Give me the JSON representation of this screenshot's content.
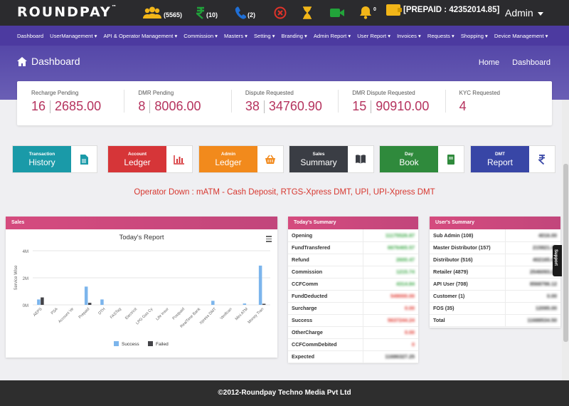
{
  "topbar": {
    "logo": "ROUNDPAY",
    "logo_mark": "™",
    "users_count": "(5565)",
    "rupee_count": "(10)",
    "calls_count": "(2)",
    "notif_count": "0",
    "prepaid": "[PREPAID : 42352014.85]",
    "admin": "Admin",
    "colors": {
      "users": "#f2b619",
      "rupee": "#20a13a",
      "phone": "#1f6fd6",
      "cancel": "#e0332a",
      "hourglass": "#f2b619",
      "video": "#22a33a",
      "bell": "#f2b619"
    }
  },
  "nav": [
    "Dashboard",
    "UserManagement ▾",
    "API & Operator Management ▾",
    "Commission ▾",
    "Masters ▾",
    "Setting ▾",
    "Branding ▾",
    "Admin Report ▾",
    "User Report ▾",
    "Invoices ▾",
    "Requests ▾",
    "Shopping ▾",
    "Device Management ▾"
  ],
  "header": {
    "title": "Dashboard",
    "breadcrumbs": [
      "Home",
      "Dashboard"
    ]
  },
  "stats": [
    {
      "label": "Recharge Pending",
      "count": "16",
      "amount": "2685.00"
    },
    {
      "label": "DMR Pending",
      "count": "8",
      "amount": "8006.00"
    },
    {
      "label": "Dispute Requested",
      "count": "38",
      "amount": "34760.90"
    },
    {
      "label": "DMR Dispute Requested",
      "count": "15",
      "amount": "90910.00"
    },
    {
      "label": "KYC Requested",
      "count": "4",
      "amount": ""
    }
  ],
  "quick": [
    {
      "sub": "Transaction",
      "label": "History",
      "color": "#1a9aa8",
      "icon": "file-icon"
    },
    {
      "sub": "Account",
      "label": "Ledger",
      "color": "#d63538",
      "icon": "bar-chart-icon"
    },
    {
      "sub": "Admin",
      "label": "Ledger",
      "color": "#f28a1c",
      "icon": "basket-icon"
    },
    {
      "sub": "Sales",
      "label": "Summary",
      "color": "#3a3d44",
      "icon": "book-open-icon"
    },
    {
      "sub": "Day",
      "label": "Book",
      "color": "#2f8a3c",
      "icon": "book-icon"
    },
    {
      "sub": "DMT",
      "label": "Report",
      "color": "#3846a6",
      "icon": "rupee-icon"
    }
  ],
  "alert": "Operator Down : mATM - Cash Deposit, RTGS-Xpress DMT, UPI, UPI-Xpress DMT",
  "sales": {
    "header": "Sales",
    "chart_data": {
      "type": "bar",
      "title": "Today's Report",
      "ylabel": "Service Wise",
      "ylim": [
        0,
        4000000
      ],
      "yticks": [
        "0M",
        "2M",
        "4M"
      ],
      "categories": [
        "AEPS",
        "PSA",
        "Account Ve",
        "Prepaid",
        "DTH",
        "FASTag",
        "Electricit",
        "LPG Gas Cy",
        "Life Insur",
        "Postpaid",
        "RealTime Bank",
        "Xpress DMT",
        "Verifican",
        "Mini ATM",
        "Money Tran"
      ],
      "series": [
        {
          "name": "Success",
          "color": "#7cb5ec",
          "values": [
            400000,
            0,
            0,
            1350000,
            400000,
            0,
            0,
            0,
            0,
            0,
            0,
            300000,
            0,
            100000,
            2900000
          ]
        },
        {
          "name": "Failed",
          "color": "#434348",
          "values": [
            550000,
            0,
            0,
            150000,
            0,
            0,
            0,
            0,
            0,
            0,
            0,
            0,
            0,
            0,
            80000
          ]
        }
      ],
      "legend": "bottom"
    }
  },
  "today": {
    "header": "Today's Summary",
    "rows": [
      {
        "label": "Opening",
        "value": "11175526.87",
        "color": "#3aa845"
      },
      {
        "label": "FundTransfered",
        "value": "6676465.57",
        "color": "#3aa845"
      },
      {
        "label": "Refund",
        "value": "2600.47",
        "color": "#3aa845"
      },
      {
        "label": "Commission",
        "value": "1215.74",
        "color": "#3aa845"
      },
      {
        "label": "CCFComm",
        "value": "4314.84",
        "color": "#3aa845"
      },
      {
        "label": "FundDeducted",
        "value": "549000.00",
        "color": "#e0332a"
      },
      {
        "label": "Surcharge",
        "value": "0.00",
        "color": "#e0332a"
      },
      {
        "label": "Success",
        "value": "5637244.24",
        "color": "#e0332a"
      },
      {
        "label": "OtherCharge",
        "value": "0.00",
        "color": "#e0332a"
      },
      {
        "label": "CCFCommDebited",
        "value": "0",
        "color": "#e0332a"
      },
      {
        "label": "Expected",
        "value": "11686327.25",
        "color": "#333333"
      }
    ]
  },
  "users": {
    "header": "User's Summary",
    "rows": [
      {
        "label": "Sub Admin (108)",
        "value": "4016.00"
      },
      {
        "label": "Master Distributor (157)",
        "value": "215821.42"
      },
      {
        "label": "Distributor (516)",
        "value": "402165.41"
      },
      {
        "label": "Retailer (4879)",
        "value": "2546093.22"
      },
      {
        "label": "API User (708)",
        "value": "8568796.12"
      },
      {
        "label": "Customer (1)",
        "value": "0.00"
      },
      {
        "label": "FOS (35)",
        "value": "12095.00"
      },
      {
        "label": "Total",
        "value": "11688534.50"
      }
    ]
  },
  "support": "Support",
  "footer": "©2012-Roundpay Techno Media Pvt Ltd"
}
